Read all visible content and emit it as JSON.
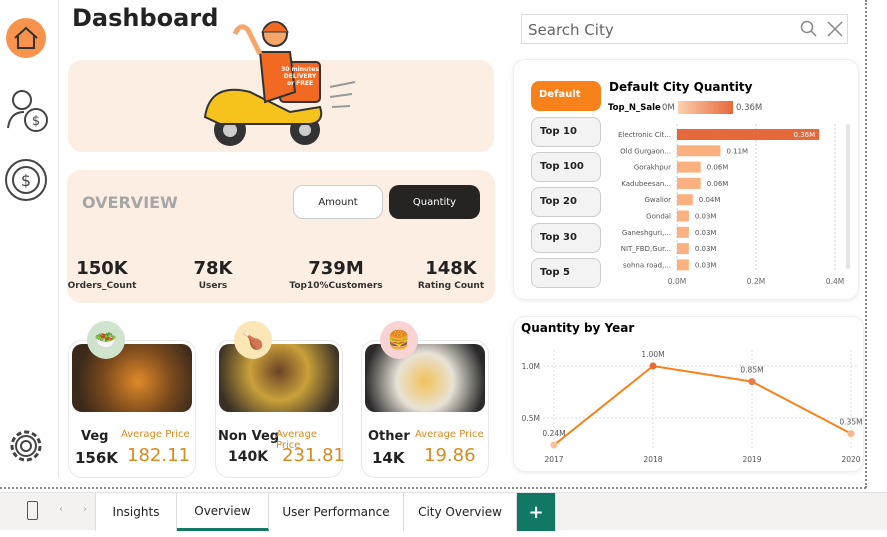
{
  "header": {
    "title": "Dashboard"
  },
  "search": {
    "placeholder": "Search City"
  },
  "sidebar": {
    "icons": [
      "home-icon",
      "user-dollar-icon",
      "dollar-circle-icon",
      "gear-icon"
    ]
  },
  "banner": {
    "sign_text": "30 minutes DELIVERY or FREE"
  },
  "overview": {
    "label": "OVERVIEW",
    "amount_label": "Amount",
    "quantity_label": "Quantity",
    "kpis": [
      {
        "value": "150K",
        "label": "Orders_Count"
      },
      {
        "value": "78K",
        "label": "Users"
      },
      {
        "value": "739M",
        "label": "Top10%Customers"
      },
      {
        "value": "148K",
        "label": "Rating Count"
      }
    ]
  },
  "cards": [
    {
      "name": "Veg",
      "count": "156K",
      "avg_label": "Average Price",
      "avg": "182.11"
    },
    {
      "name": "Non Veg",
      "count": "140K",
      "avg_label": "Average Price",
      "avg": "231.81"
    },
    {
      "name": "Other",
      "count": "14K",
      "avg_label": "Average Price",
      "avg": "19.86"
    }
  ],
  "top_buttons": [
    "Default",
    "Top 10",
    "Top 100",
    "Top 20",
    "Top 30",
    "Top 5"
  ],
  "colors": {
    "accent": "#f7821b",
    "bar_dark": "#e5693a",
    "bar_light": "#fbb07f",
    "tab_green": "#117865"
  },
  "chart_data": [
    {
      "type": "bar",
      "title": "Default City Quantity",
      "legend_label": "Top_N_Sale",
      "legend_min": "0M",
      "legend_max": "0.36M",
      "categories": [
        "Electronic Cit...",
        "Old Gurgaon...",
        "Gorakhpur",
        "Kadubeesan...",
        "Gwalior",
        "Gondal",
        "Ganeshguri,...",
        "NIT_FBD,Gur...",
        "sohna road,..."
      ],
      "values": [
        0.36,
        0.11,
        0.06,
        0.06,
        0.04,
        0.03,
        0.03,
        0.03,
        0.03
      ],
      "labels": [
        "0.36M",
        "0.11M",
        "0.06M",
        "0.06M",
        "0.04M",
        "0.03M",
        "0.03M",
        "0.03M",
        "0.03M"
      ],
      "xticks": [
        "0.0M",
        "0.2M",
        "0.4M"
      ],
      "xlim": [
        0,
        0.4
      ],
      "unit": "M"
    },
    {
      "type": "line",
      "title": "Quantity by Year",
      "x": [
        "2017",
        "2018",
        "2019",
        "2020"
      ],
      "values": [
        0.24,
        1.0,
        0.85,
        0.35
      ],
      "labels": [
        "0.24M",
        "1.00M",
        "0.85M",
        "0.35M"
      ],
      "yticks": [
        "0.5M",
        "1.0M"
      ],
      "ylim": [
        0,
        1.15
      ]
    }
  ],
  "tabs": {
    "items": [
      "Insights",
      "Overview",
      "User Performance",
      "City Overview"
    ],
    "active": "Overview",
    "add": "+"
  }
}
